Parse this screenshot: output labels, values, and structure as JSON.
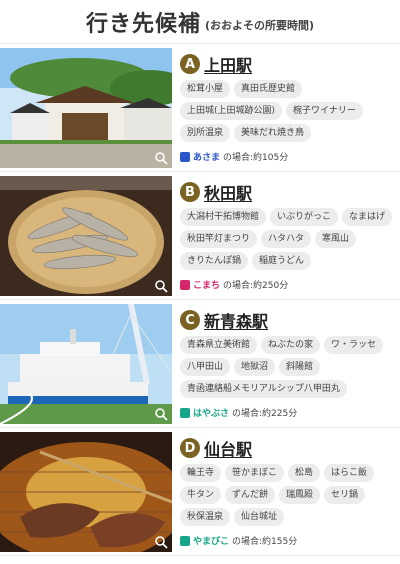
{
  "header": {
    "title": "行き先候補",
    "subtitle": "(おおよその所要時間)"
  },
  "destinations": [
    {
      "letter": "A",
      "name": "上田駅",
      "spots": [
        "松茸小屋",
        "真田氏歴史館",
        "上田城(上田城跡公園)",
        "椀子ワイナリー",
        "別所温泉",
        "美味だれ焼き鳥"
      ],
      "train": "あさま",
      "duration": "の場合:約105分",
      "train_color": "#2b56c9"
    },
    {
      "letter": "B",
      "name": "秋田駅",
      "spots": [
        "大潟村干拓博物館",
        "いぶりがっこ",
        "なまはげ",
        "秋田竿灯まつり",
        "ハタハタ",
        "寒風山",
        "きりたんぽ鍋",
        "稲庭うどん"
      ],
      "train": "こまち",
      "duration": "の場合:約250分",
      "train_color": "#d6266b"
    },
    {
      "letter": "C",
      "name": "新青森駅",
      "spots": [
        "青森県立美術館",
        "ねぶたの家",
        "ワ・ラッセ",
        "八甲田山",
        "地獄沼",
        "斜陽館",
        "青函連絡船メモリアルシップ八甲田丸"
      ],
      "train": "はやぶさ",
      "duration": "の場合:約225分",
      "train_color": "#17a58a"
    },
    {
      "letter": "D",
      "name": "仙台駅",
      "spots": [
        "輪王寺",
        "笹かまぼこ",
        "松島",
        "はらこ飯",
        "牛タン",
        "ずんだ餅",
        "瑞鳳殿",
        "セリ鍋",
        "秋保温泉",
        "仙台城址"
      ],
      "train": "やまびこ",
      "duration": "の場合:約155分",
      "train_color": "#17a58a"
    }
  ]
}
